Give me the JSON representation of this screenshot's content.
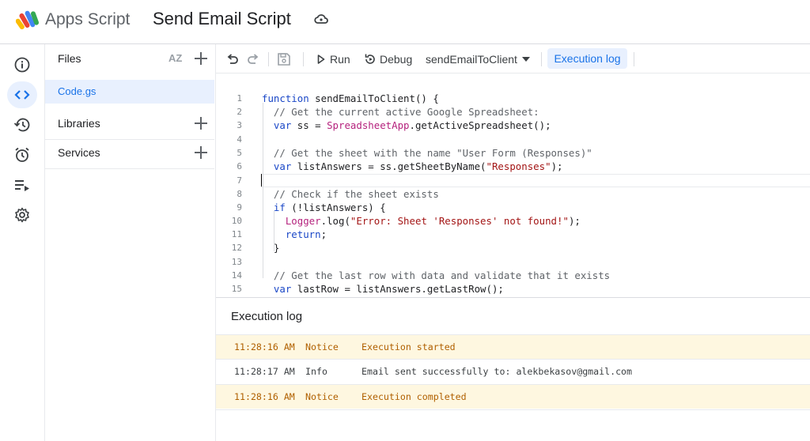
{
  "header": {
    "app_name": "Apps Script",
    "project_title": "Send Email Script"
  },
  "files_panel": {
    "title": "Files",
    "sort_label": "AZ",
    "files": [
      {
        "name": "Code.gs"
      }
    ],
    "sections": [
      {
        "label": "Libraries"
      },
      {
        "label": "Services"
      }
    ]
  },
  "toolbar": {
    "run_label": "Run",
    "debug_label": "Debug",
    "function_select": "sendEmailToClient",
    "execution_log_label": "Execution log"
  },
  "editor": {
    "line_numbers": [
      "1",
      "2",
      "3",
      "4",
      "5",
      "6",
      "7",
      "8",
      "9",
      "10",
      "11",
      "12",
      "13",
      "14",
      "15"
    ]
  },
  "log": {
    "title": "Execution log",
    "entries": [
      {
        "time": "11:28:16 AM",
        "level": "Notice",
        "message": "Execution started"
      },
      {
        "time": "11:28:17 AM",
        "level": "Info",
        "message": "Email sent successfully to: alekbekasov@gmail.com"
      },
      {
        "time": "11:28:16 AM",
        "level": "Notice",
        "message": "Execution completed"
      }
    ]
  },
  "colors": {
    "accent": "#1a73e8",
    "notice_bg": "#fef7e0",
    "notice_text": "#b06000"
  }
}
